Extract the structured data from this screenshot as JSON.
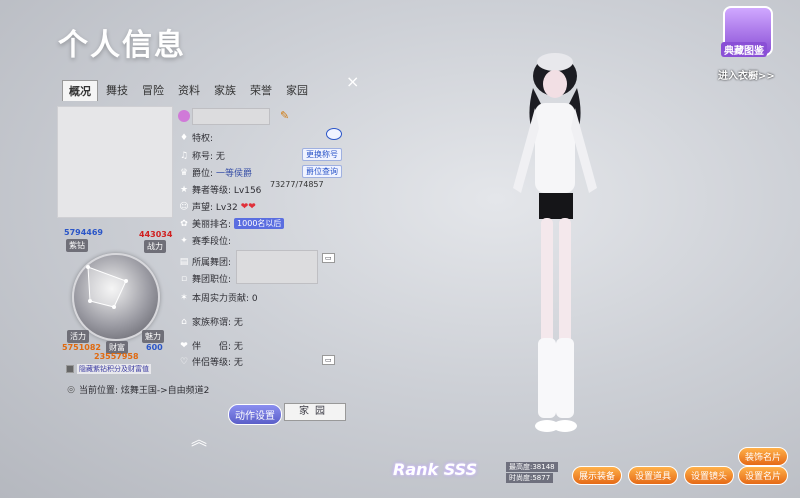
{
  "header": {
    "title": "个人信息",
    "close_symbol": "×"
  },
  "tabs": [
    {
      "label": "概况",
      "active": true
    },
    {
      "label": "舞技",
      "active": false
    },
    {
      "label": "冒险",
      "active": false
    },
    {
      "label": "资料",
      "active": false
    },
    {
      "label": "家族",
      "active": false
    },
    {
      "label": "荣誉",
      "active": false
    },
    {
      "label": "家园",
      "active": false
    }
  ],
  "stats": {
    "purple_diamond_value": "5794469",
    "purple_diamond_label": "紫钻",
    "combat_value": "443034",
    "combat_label": "战力",
    "vitality_label": "活力",
    "wealth_label": "财富",
    "charm_label": "魅力",
    "vitality_value": "5751082",
    "wealth_value": "23557958",
    "charm_value": "600",
    "hide_checkbox_label": "隐藏紫钻积分及财富值"
  },
  "info": {
    "traits_label": "特权:",
    "title_label": "称号: 无",
    "change_title_btn": "更换称号",
    "rank_label": "爵位:",
    "rank_value": "一等侯爵",
    "rank_query_btn": "爵位查询",
    "dance_level_label": "舞者等级: Lv156",
    "dance_exp": "73277/74857",
    "prestige_label": "声望: Lv32",
    "beauty_label": "美丽排名:",
    "beauty_badge": "1000名以后",
    "season_label": "赛季段位:",
    "troupe_label": "所属舞团:",
    "troupe_role_label": "舞团职位:",
    "weekly_contrib_label": "本周实力贡献: 0",
    "family_title_label": "家族称谓: 无",
    "partner_label": "伴　　侣: 无",
    "buddy_level_label": "伴侣等级: 无",
    "location_label": "当前位置: 炫舞王国->自由频道2"
  },
  "buttons": {
    "action_setting": "动作设置",
    "family": "家园",
    "expand_up": "︽"
  },
  "top_right": {
    "album_label": "典藏图鉴",
    "wardrobe_link": "进入衣橱>>"
  },
  "bottom": {
    "rank_logo": "Rank SSS",
    "popularity": "最高度:38148",
    "affinity": "时尚度:5877",
    "show_gear": "展示装备",
    "set_props": "设置道具",
    "set_camera": "设置镜头",
    "set_card": "设置名片",
    "equip_card": "装饰名片"
  },
  "colors": {
    "orange": "#ff9a3a",
    "blue_btn": "#2b56c8",
    "purple": "#8a4fd6"
  }
}
